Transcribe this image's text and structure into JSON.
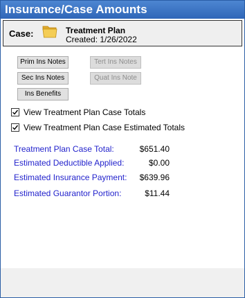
{
  "window": {
    "title": "Insurance/Case Amounts"
  },
  "case": {
    "label": "Case:",
    "name": "Treatment Plan",
    "created": "Created: 1/26/2022"
  },
  "buttons": {
    "prim_ins_notes": "Prim Ins Notes",
    "tert_ins_notes": "Tert Ins Notes",
    "sec_ins_notes": "Sec Ins Notes",
    "quat_ins_note": "Quat Ins Note",
    "ins_benefits": "Ins Benefits"
  },
  "checkboxes": [
    {
      "label": "View Treatment Plan Case Totals",
      "checked": true
    },
    {
      "label": "View Treatment Plan Case Estimated Totals",
      "checked": true
    }
  ],
  "summary": [
    {
      "label": "Treatment Plan Case Total:",
      "value": "$651.40"
    },
    {
      "label": "Estimated Deductible Applied:",
      "value": "$0.00"
    },
    {
      "label": "Estimated Insurance Payment:",
      "value": "$639.96"
    },
    {
      "label": "Estimated Guarantor Portion:",
      "value": "$11.44"
    }
  ],
  "colors": {
    "titlebar": "#2f66b8",
    "summary_label": "#2222cc",
    "folder": "#f2c94c"
  },
  "icons": {
    "folder": "folder-icon",
    "check": "checkmark-icon",
    "grip": "resize-grip-icon"
  }
}
